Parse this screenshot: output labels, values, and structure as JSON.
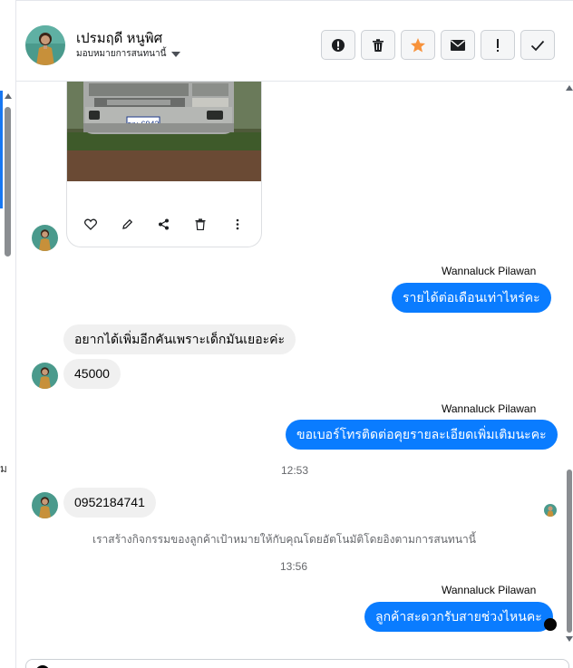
{
  "contact": {
    "name": "เปรมฤดี หนูพิศ",
    "assign_label": "มอบหมายการสนทนานี้"
  },
  "header_actions": [
    {
      "icon": "alert-circle-icon",
      "label": "Mark as spam"
    },
    {
      "icon": "trash-icon",
      "label": "Delete"
    },
    {
      "icon": "star-icon",
      "label": "Star",
      "color": "#f7923b"
    },
    {
      "icon": "envelope-icon",
      "label": "Mark unread"
    },
    {
      "icon": "exclamation-icon",
      "label": "Follow up"
    },
    {
      "icon": "check-icon",
      "label": "Done"
    }
  ],
  "photo": {
    "plate_text": "ฆษ 6943"
  },
  "card_actions": [
    "heart-icon",
    "pencil-icon",
    "share-icon",
    "trash-icon",
    "more-icon"
  ],
  "messages": {
    "agent_name": "Wannaluck Pilawan",
    "out_1": "รายได้ต่อเดือนเท่าไหร่คะ",
    "in_1": "อยากได้เพิ่มอีกคันเพราะเด็กมันเยอะค่ะ",
    "in_2": "45000",
    "out_2": "ขอเบอร์โทรติดต่อคุยรายละเอียดเพิ่มเติมนะคะ",
    "time_1": "12:53",
    "in_3": "0952184741",
    "system_note": "เราสร้างกิจกรรมของลูกค้าเป้าหมายให้กับคุณโดยอัตโนมัติโดยอิงตามการสนทนานี้",
    "time_2": "13:56",
    "out_3": "ลูกค้าสะดวกรับสายช่วงไหนคะ"
  },
  "colors": {
    "outgoing_bubble": "#0a7cff",
    "incoming_bubble": "#f0f0f0",
    "star": "#f7923b"
  }
}
